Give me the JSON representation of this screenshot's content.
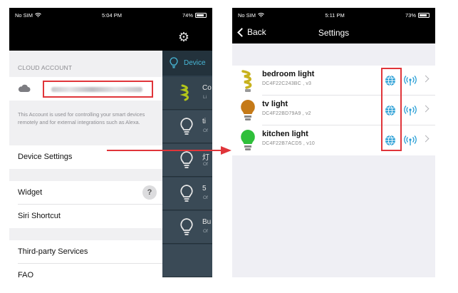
{
  "left_screen": {
    "status_bar": {
      "carrier": "No SIM",
      "time": "5:04 PM",
      "battery": "74%"
    },
    "header": {
      "settings_icon": "gear-icon"
    },
    "cloud_account": {
      "section_label": "CLOUD ACCOUNT",
      "icon": "cloud-icon",
      "description": "This Account is used for controlling your smart devices remotely and for external integrations such as Alexa."
    },
    "menu": {
      "device_settings": "Device Settings",
      "widget": "Widget",
      "widget_help": "?",
      "siri_shortcut": "Siri Shortcut",
      "third_party": "Third-party Services",
      "faq": "FAQ"
    },
    "device_panel": {
      "tab_label": "Device",
      "rows": [
        {
          "title": "Co",
          "sub": "Li"
        },
        {
          "title": "ti",
          "sub": "Of"
        },
        {
          "title": "灯",
          "sub": "Of"
        },
        {
          "title": "5",
          "sub": "Of"
        },
        {
          "title": "Bu",
          "sub": "Of"
        }
      ]
    }
  },
  "right_screen": {
    "status_bar": {
      "carrier": "No SIM",
      "time": "5:11 PM",
      "battery": "73%"
    },
    "nav": {
      "back_label": "Back",
      "title": "Settings"
    },
    "lights": [
      {
        "name": "bedroom light",
        "detail": "DC4F22C243BC , v3",
        "bulb_color": "#c8b21e",
        "icon": "bulb-icon"
      },
      {
        "name": "tv light",
        "detail": "DC4F22BD79A9 , v2",
        "bulb_color": "#c57a18",
        "icon": "bulb-icon"
      },
      {
        "name": "kitchen light",
        "detail": "DC4F22B7ACD5 , v10",
        "bulb_color": "#2fbf3a",
        "icon": "bulb-icon"
      }
    ]
  },
  "colors": {
    "highlight": "#e0353a",
    "dark_panel": "#2e3f4c",
    "accent": "#48b8d8"
  }
}
